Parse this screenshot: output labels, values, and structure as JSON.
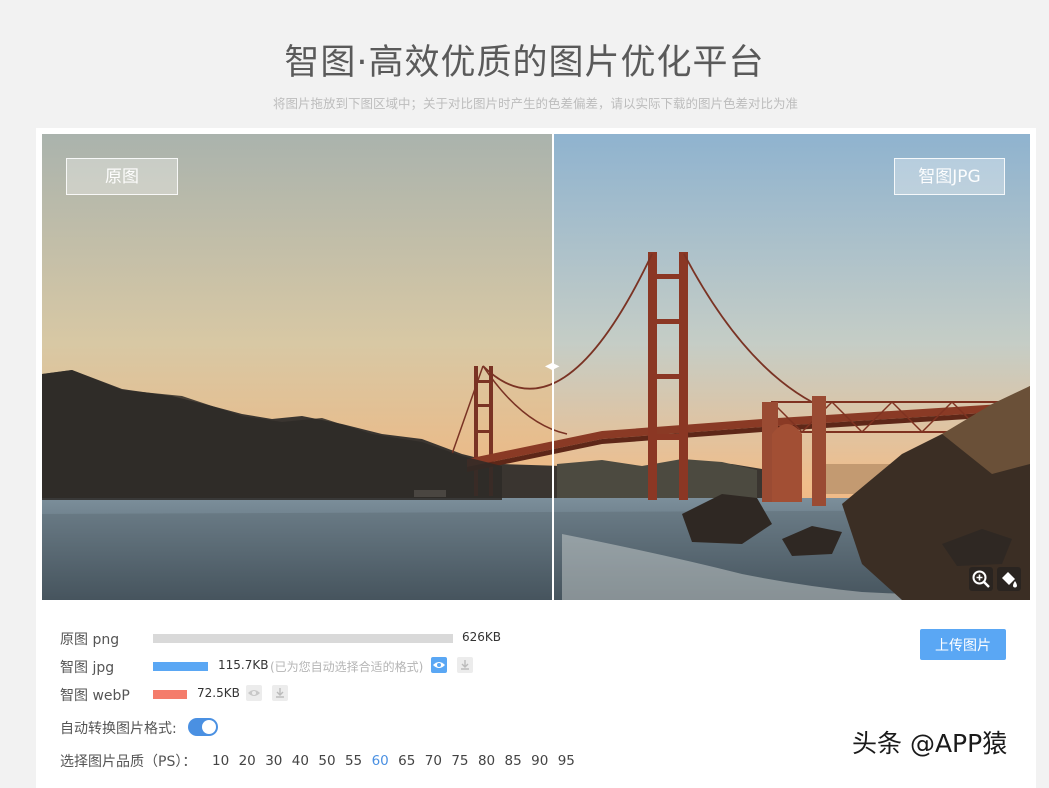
{
  "header": {
    "title": "智图·高效优质的图片优化平台",
    "subtitle": "将图片拖放到下图区域中；关于对比图片时产生的色差偏差，请以实际下载的图片色差对比为准"
  },
  "compare": {
    "left_tag": "原图",
    "right_tag": "智图JPG",
    "split_percent": 51.7
  },
  "results": [
    {
      "label": "原图 png",
      "size": "626KB",
      "bar_fraction": 1.0,
      "color": "#d9d9d9",
      "note": ""
    },
    {
      "label": "智图 jpg",
      "size": "115.7KB",
      "bar_fraction": 0.185,
      "color": "#5aa7f4",
      "note": "(已为您自动选择合适的格式)"
    },
    {
      "label": "智图 webP",
      "size": "72.5KB",
      "bar_fraction": 0.116,
      "color": "#f47c6b",
      "note": ""
    }
  ],
  "upload_label": "上传图片",
  "auto_convert": {
    "label": "自动转换图片格式:",
    "enabled": true
  },
  "quality": {
    "label": "选择图片品质（PS）：",
    "options": [
      "10",
      "20",
      "30",
      "40",
      "50",
      "55",
      "60",
      "65",
      "70",
      "75",
      "80",
      "85",
      "90",
      "95"
    ],
    "selected": "60"
  },
  "watermark": "头条 @APP猿",
  "colors": {
    "accent": "#5aa7f4",
    "webp": "#f47c6b",
    "toggle": "#4a90e2"
  },
  "icons": [
    "zoom-in-icon",
    "paint-bucket-icon",
    "eye-icon",
    "download-icon"
  ]
}
